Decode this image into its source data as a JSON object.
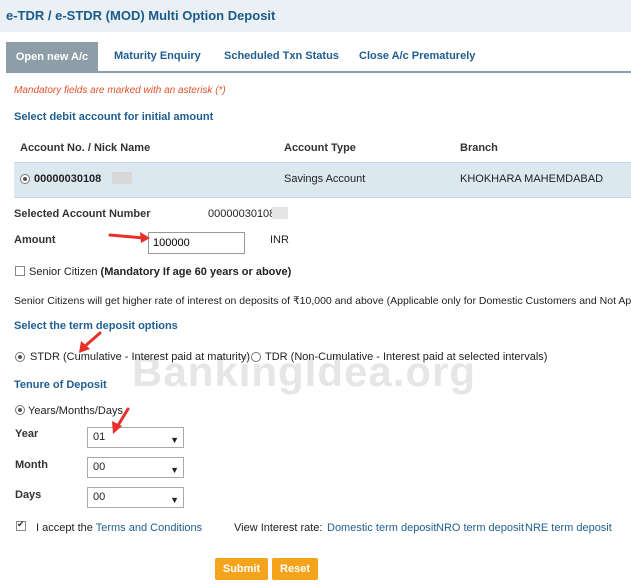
{
  "header": {
    "title": "e-TDR / e-STDR (MOD) Multi Option Deposit"
  },
  "tabs": [
    "Open new A/c",
    "Maturity Enquiry",
    "Scheduled Txn Status",
    "Close A/c Prematurely"
  ],
  "mandatory_note": "Mandatory fields are marked with an asterisk (*)",
  "debit_section": "Select debit account for initial amount",
  "table": {
    "headers": [
      "Account No. / Nick Name",
      "Account Type",
      "Branch"
    ],
    "row": {
      "account": "00000030108",
      "type": "Savings Account",
      "branch": "KHOKHARA MAHEMDABAD"
    }
  },
  "selected_account": {
    "label": "Selected Account Number",
    "value": "00000030108"
  },
  "amount": {
    "label": "Amount",
    "value": "100000",
    "unit": "INR"
  },
  "senior": {
    "label": "Senior Citizen",
    "note": "(Mandatory If age 60 years or above)",
    "info": "Senior Citizens will get higher rate of interest on deposits of ₹10,000 and above (Applicable only for Domestic Customers and Not App"
  },
  "term_section": "Select the term deposit options",
  "term_options": [
    "STDR (Cumulative - Interest paid at maturity)",
    "TDR (Non-Cumulative - Interest paid at selected intervals)"
  ],
  "tenure_section": "Tenure of Deposit",
  "tenure_mode": "Years/Months/Days",
  "year": {
    "label": "Year",
    "value": "01"
  },
  "month": {
    "label": "Month",
    "value": "00"
  },
  "days": {
    "label": "Days",
    "value": "00"
  },
  "terms": {
    "prefix": "I accept the",
    "link": "Terms and Conditions"
  },
  "interest": {
    "label": "View Interest rate:",
    "links": [
      "Domestic term deposit",
      "NRO term deposit",
      "NRE term deposit"
    ]
  },
  "buttons": {
    "submit": "Submit",
    "reset": "Reset"
  },
  "watermark": "BankingIdea.org",
  "colors": {
    "accent": "#1f5e92",
    "button": "#f5a31b",
    "tab_active": "#8e9ea8",
    "mandatory": "#e0532c",
    "arrow": "#e8302a"
  }
}
